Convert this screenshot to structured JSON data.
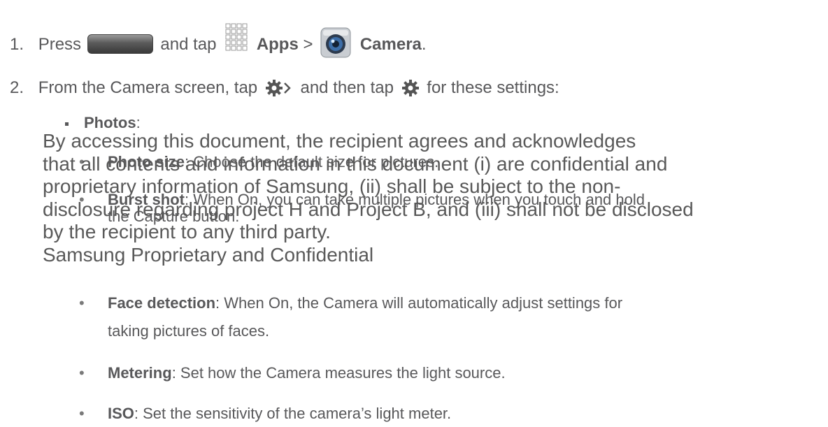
{
  "step1": {
    "number": "1.",
    "press": "Press",
    "and_tap": "and tap",
    "apps": "Apps",
    "sep": ">",
    "camera": "Camera",
    "end": "."
  },
  "step2": {
    "number": "2.",
    "text_a": "From the Camera screen, tap",
    "text_b": "and then tap",
    "text_c": "for these settings:"
  },
  "photos": {
    "label": "Photos",
    "suffix": ":"
  },
  "items": [
    {
      "bold": "Photo size",
      "text": ": Choose the default size for pictures."
    },
    {
      "bold": "Burst shot",
      "text": ": When On, you can take multiple pictures when you touch and hold",
      "text2": "the Capture button."
    },
    {
      "bold": "Face detection",
      "text": ": When On, the Camera will automatically adjust settings for",
      "text2": "taking pictures of faces."
    },
    {
      "bold": "Metering",
      "text": ": Set how the Camera measures the light source."
    },
    {
      "bold": "ISO",
      "text": ": Set the sensitivity of the camera’s light meter."
    }
  ],
  "watermark": {
    "line1": "By accessing this document, the recipient agrees and acknowledges",
    "line2": "that all contents and information in this document (i) are confidential and",
    "line3": "proprietary information of Samsung, (ii) shall be subject to the non-",
    "line4": "disclosure regarding project H and Project B, and (iii) shall not be disclosed",
    "line5": "by the recipient to any third party.",
    "line6": "Samsung Proprietary and Confidential"
  }
}
